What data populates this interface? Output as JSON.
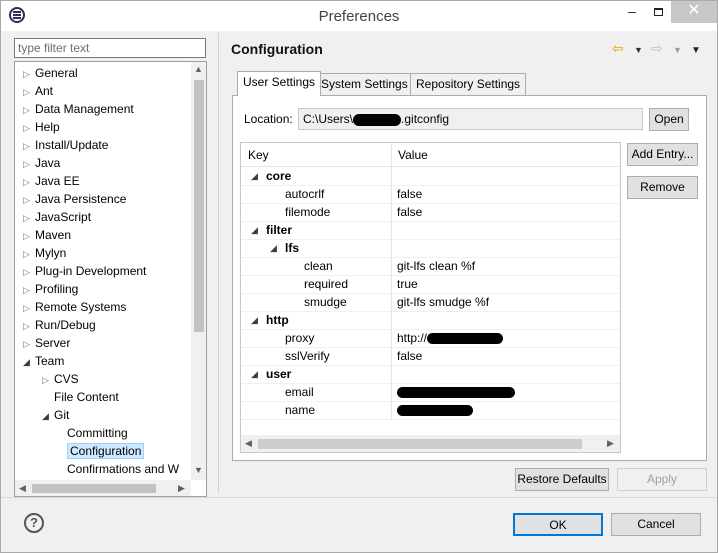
{
  "window": {
    "title": "Preferences",
    "minimize": "–",
    "close": "✕"
  },
  "filter": {
    "placeholder": "type filter text"
  },
  "tree": [
    {
      "label": "General",
      "indent": 0,
      "arrow": "closed"
    },
    {
      "label": "Ant",
      "indent": 0,
      "arrow": "closed"
    },
    {
      "label": "Data Management",
      "indent": 0,
      "arrow": "closed"
    },
    {
      "label": "Help",
      "indent": 0,
      "arrow": "closed"
    },
    {
      "label": "Install/Update",
      "indent": 0,
      "arrow": "closed"
    },
    {
      "label": "Java",
      "indent": 0,
      "arrow": "closed"
    },
    {
      "label": "Java EE",
      "indent": 0,
      "arrow": "closed"
    },
    {
      "label": "Java Persistence",
      "indent": 0,
      "arrow": "closed"
    },
    {
      "label": "JavaScript",
      "indent": 0,
      "arrow": "closed"
    },
    {
      "label": "Maven",
      "indent": 0,
      "arrow": "closed"
    },
    {
      "label": "Mylyn",
      "indent": 0,
      "arrow": "closed"
    },
    {
      "label": "Plug-in Development",
      "indent": 0,
      "arrow": "closed"
    },
    {
      "label": "Profiling",
      "indent": 0,
      "arrow": "closed"
    },
    {
      "label": "Remote Systems",
      "indent": 0,
      "arrow": "closed"
    },
    {
      "label": "Run/Debug",
      "indent": 0,
      "arrow": "closed"
    },
    {
      "label": "Server",
      "indent": 0,
      "arrow": "closed"
    },
    {
      "label": "Team",
      "indent": 0,
      "arrow": "open"
    },
    {
      "label": "CVS",
      "indent": 1,
      "arrow": "closed"
    },
    {
      "label": "File Content",
      "indent": 1,
      "arrow": "none"
    },
    {
      "label": "Git",
      "indent": 1,
      "arrow": "open"
    },
    {
      "label": "Committing",
      "indent": 2,
      "arrow": "none"
    },
    {
      "label": "Configuration",
      "indent": 2,
      "arrow": "none",
      "selected": true
    },
    {
      "label": "Confirmations and W",
      "indent": 2,
      "arrow": "none"
    }
  ],
  "page": {
    "title": "Configuration"
  },
  "tabs": {
    "user": "User Settings",
    "system": "System Settings",
    "repository": "Repository Settings"
  },
  "location": {
    "label": "Location:",
    "prefix": "C:\\Users\\",
    "suffix": ".gitconfig"
  },
  "buttons": {
    "open": "Open",
    "add_entry": "Add Entry...",
    "remove": "Remove",
    "restore_defaults": "Restore Defaults",
    "apply": "Apply",
    "ok": "OK",
    "cancel": "Cancel"
  },
  "table": {
    "headers": {
      "key": "Key",
      "value": "Value"
    },
    "rows": [
      {
        "key": "core",
        "value": "",
        "level": 0,
        "section": true,
        "redact": 0
      },
      {
        "key": "autocrlf",
        "value": "false",
        "level": 1,
        "section": false,
        "redact": 0
      },
      {
        "key": "filemode",
        "value": "false",
        "level": 1,
        "section": false,
        "redact": 0
      },
      {
        "key": "filter",
        "value": "",
        "level": 0,
        "section": true,
        "redact": 0
      },
      {
        "key": "lfs",
        "value": "",
        "level": 1,
        "section": true,
        "redact": 0
      },
      {
        "key": "clean",
        "value": "git-lfs clean %f",
        "level": 2,
        "section": false,
        "redact": 0
      },
      {
        "key": "required",
        "value": "true",
        "level": 2,
        "section": false,
        "redact": 0
      },
      {
        "key": "smudge",
        "value": "git-lfs smudge %f",
        "level": 2,
        "section": false,
        "redact": 0
      },
      {
        "key": "http",
        "value": "",
        "level": 0,
        "section": true,
        "redact": 0
      },
      {
        "key": "proxy",
        "value": "http://",
        "level": 1,
        "section": false,
        "redact": 76
      },
      {
        "key": "sslVerify",
        "value": "false",
        "level": 1,
        "section": false,
        "redact": 0
      },
      {
        "key": "user",
        "value": "",
        "level": 0,
        "section": true,
        "redact": 0
      },
      {
        "key": "email",
        "value": "",
        "level": 1,
        "section": false,
        "redact": 118
      },
      {
        "key": "name",
        "value": "",
        "level": 1,
        "section": false,
        "redact": 76
      }
    ]
  },
  "help": {
    "glyph": "?"
  }
}
